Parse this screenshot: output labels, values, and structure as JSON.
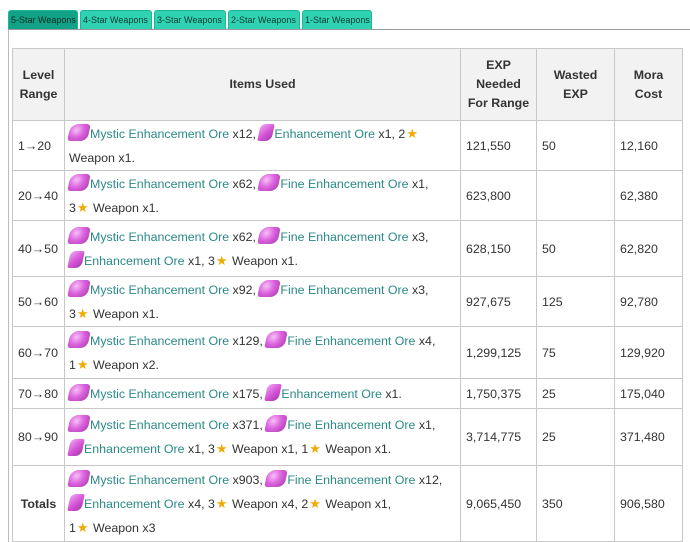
{
  "tabs": [
    "5-Star Weapons",
    "4-Star Weapons",
    "3-Star Weapons",
    "2-Star Weapons",
    "1-Star Weapons"
  ],
  "headers": {
    "level": "Level Range",
    "items": "Items Used",
    "exp": "EXP Needed For Range",
    "wasted": "Wasted EXP",
    "mora": "Mora Cost"
  },
  "links": {
    "mystic": "Mystic Enhancement Ore",
    "fine": "Fine Enhancement Ore",
    "enh": "Enhancement Ore"
  },
  "weapon_word": "Weapon",
  "rows": [
    {
      "level": "1→20",
      "exp": "121,550",
      "wasted": "50",
      "mora": "12,160",
      "q": {
        "myst": " x12, ",
        "ore1": " x1, ",
        "w1": "2",
        "w1q": " Weapon x1."
      }
    },
    {
      "level": "20→40",
      "exp": "623,800",
      "wasted": "",
      "mora": "62,380",
      "q": {
        "myst": " x62, ",
        "fine": " x1,",
        "w1": "3",
        "w1q": " Weapon x1."
      }
    },
    {
      "level": "40→50",
      "exp": "628,150",
      "wasted": "50",
      "mora": "62,820",
      "q": {
        "myst": " x62, ",
        "fine": " x3,",
        "enh": " x1, ",
        "w1": "3",
        "w1q": " Weapon x1."
      }
    },
    {
      "level": "50→60",
      "exp": "927,675",
      "wasted": "125",
      "mora": "92,780",
      "q": {
        "myst": " x92, ",
        "fine": " x3,",
        "w1": "3",
        "w1q": " Weapon x1."
      }
    },
    {
      "level": "60→70",
      "exp": "1,299,125",
      "wasted": "75",
      "mora": "129,920",
      "q": {
        "myst": " x129, ",
        "fine": " x4,",
        "w1": "1",
        "w1q": " Weapon x2."
      }
    },
    {
      "level": "70→80",
      "exp": "1,750,375",
      "wasted": "25",
      "mora": "175,040",
      "q": {
        "myst": " x175, ",
        "enh": " x1."
      }
    },
    {
      "level": "80→90",
      "exp": "3,714,775",
      "wasted": "25",
      "mora": "371,480",
      "q": {
        "myst": " x371, ",
        "fine": " x1,",
        "enh": " x1, ",
        "w1": "3",
        "w1q": " Weapon x1, ",
        "w2": "1",
        "w2q": " Weapon x1."
      }
    },
    {
      "level": "Totals",
      "exp": "9,065,450",
      "wasted": "350",
      "mora": "906,580",
      "q": {
        "myst": " x903, ",
        "fine": " x12, ",
        "enh": " x4, ",
        "w1": "3",
        "w1q": " Weapon x4, ",
        "w2": "2",
        "w2q": " Weapon x1, ",
        "w3": "1",
        "w3q": " Weapon x3"
      }
    }
  ],
  "colors": {
    "tab": "#2fd3b4",
    "tab_active": "#11a287",
    "link": "#2a8a87",
    "star": "#f2a900",
    "ore": "#d452d6"
  }
}
